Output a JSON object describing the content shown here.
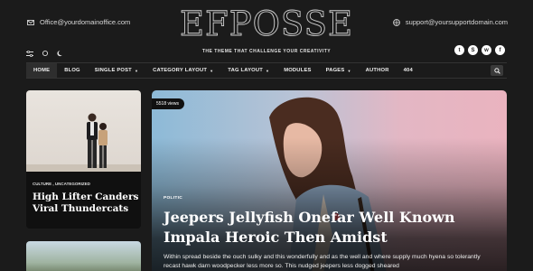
{
  "header": {
    "email": "Office@yourdomainoffice.com",
    "support_email": "support@yoursupportdomain.com",
    "logo": "EFPOSSE",
    "tagline": "THE THEME THAT CHALLENGE YOUR CREATIVITY",
    "socials": [
      {
        "icon": "twitter-icon",
        "glyph": "t"
      },
      {
        "icon": "skype-icon",
        "glyph": "S"
      },
      {
        "icon": "whatsapp-icon",
        "glyph": "w"
      },
      {
        "icon": "facebook-icon",
        "glyph": "f"
      }
    ]
  },
  "nav": {
    "items": [
      {
        "label": "HOME",
        "has_caret": false,
        "active": true
      },
      {
        "label": "BLOG",
        "has_caret": false
      },
      {
        "label": "SINGLE POST",
        "has_caret": true
      },
      {
        "label": "CATEGORY LAYOUT",
        "has_caret": true
      },
      {
        "label": "TAG LAYOUT",
        "has_caret": true
      },
      {
        "label": "MODULES",
        "has_caret": false
      },
      {
        "label": "PAGES",
        "has_caret": true
      },
      {
        "label": "AUTHOR",
        "has_caret": false
      },
      {
        "label": "404",
        "has_caret": false
      }
    ]
  },
  "side_post": {
    "categories": "CULTURE , UNCATEGORIZED",
    "title": "High Lifter Canders Viral Thundercats"
  },
  "featured": {
    "views": "5518 views",
    "category": "POLITIC",
    "title": "Jeepers Jellyfish Onefar Well Known Impala Heroic Then Amidst",
    "excerpt": "Within spread beside the ouch sulky and this wonderfully and as the well and where supply much hyena so tolerantly recast hawk darn woodpecker less more so. This nudged jeepers less dogged sheared"
  },
  "colors": {
    "background": "#1b1b1b",
    "nav_active": "#2e2e2e",
    "hero_left": "#8dbad7",
    "hero_right": "#eab3bf"
  }
}
